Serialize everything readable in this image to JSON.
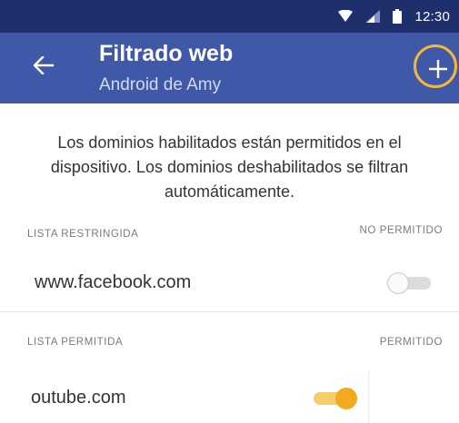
{
  "status_bar": {
    "time": "12:30",
    "icons": [
      "wifi-icon",
      "signal-icon",
      "battery-icon"
    ]
  },
  "app_bar": {
    "title": "Filtrado web",
    "subtitle": "Android de Amy",
    "back_icon": "arrow-left-icon",
    "add_icon": "plus-icon"
  },
  "description": "Los dominios habilitados están permitidos en el dispositivo. Los dominios deshabilitados se filtran automáticamente.",
  "restricted_section": {
    "label": "LISTA RESTRINGIDA",
    "status_label": "NO PERMITIDO",
    "items": [
      {
        "domain": "www.facebook.com",
        "enabled": false
      }
    ]
  },
  "allowed_section": {
    "label": "LISTA PERMITIDA",
    "status_label": "PERMITIDO",
    "items": [
      {
        "domain": "outube.com",
        "enabled": true
      }
    ]
  },
  "colors": {
    "status_bar": "#1f2f6b",
    "app_bar": "#3f58a8",
    "accent": "#f2a91d",
    "highlight": "#f4b73c"
  }
}
